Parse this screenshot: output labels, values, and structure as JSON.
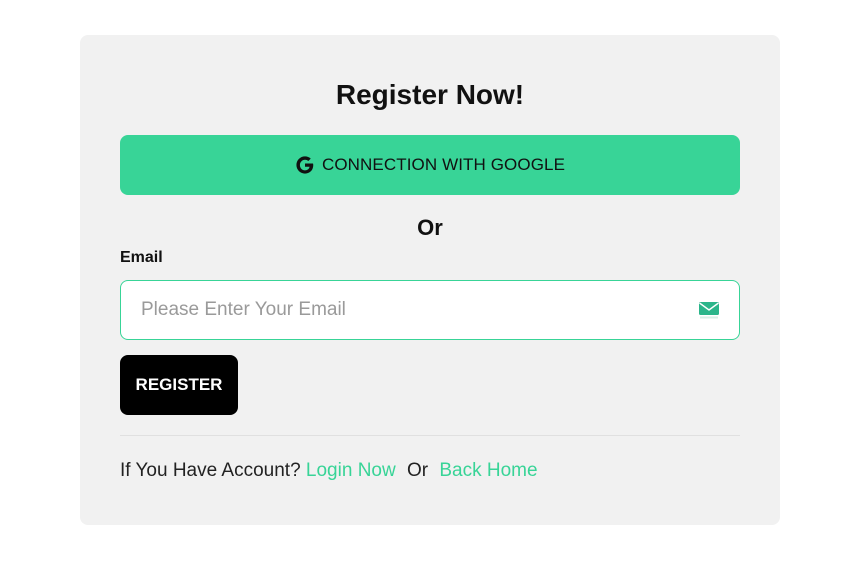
{
  "form": {
    "title": "Register Now!",
    "google_button_label": "CONNECTION WITH GOOGLE",
    "or_text": "Or",
    "email_label": "Email",
    "email_placeholder": "Please Enter Your Email",
    "email_value": "",
    "register_button_label": "REGISTER"
  },
  "footer": {
    "prompt": "If You Have Account?",
    "login_link": "Login Now",
    "or_text": "Or",
    "home_link": "Back Home"
  },
  "icons": {
    "google": "google-g-icon",
    "email": "mail-envelope-icon"
  },
  "colors": {
    "accent": "#38d497",
    "card_bg": "#f1f1f1",
    "register_bg": "#000000"
  }
}
